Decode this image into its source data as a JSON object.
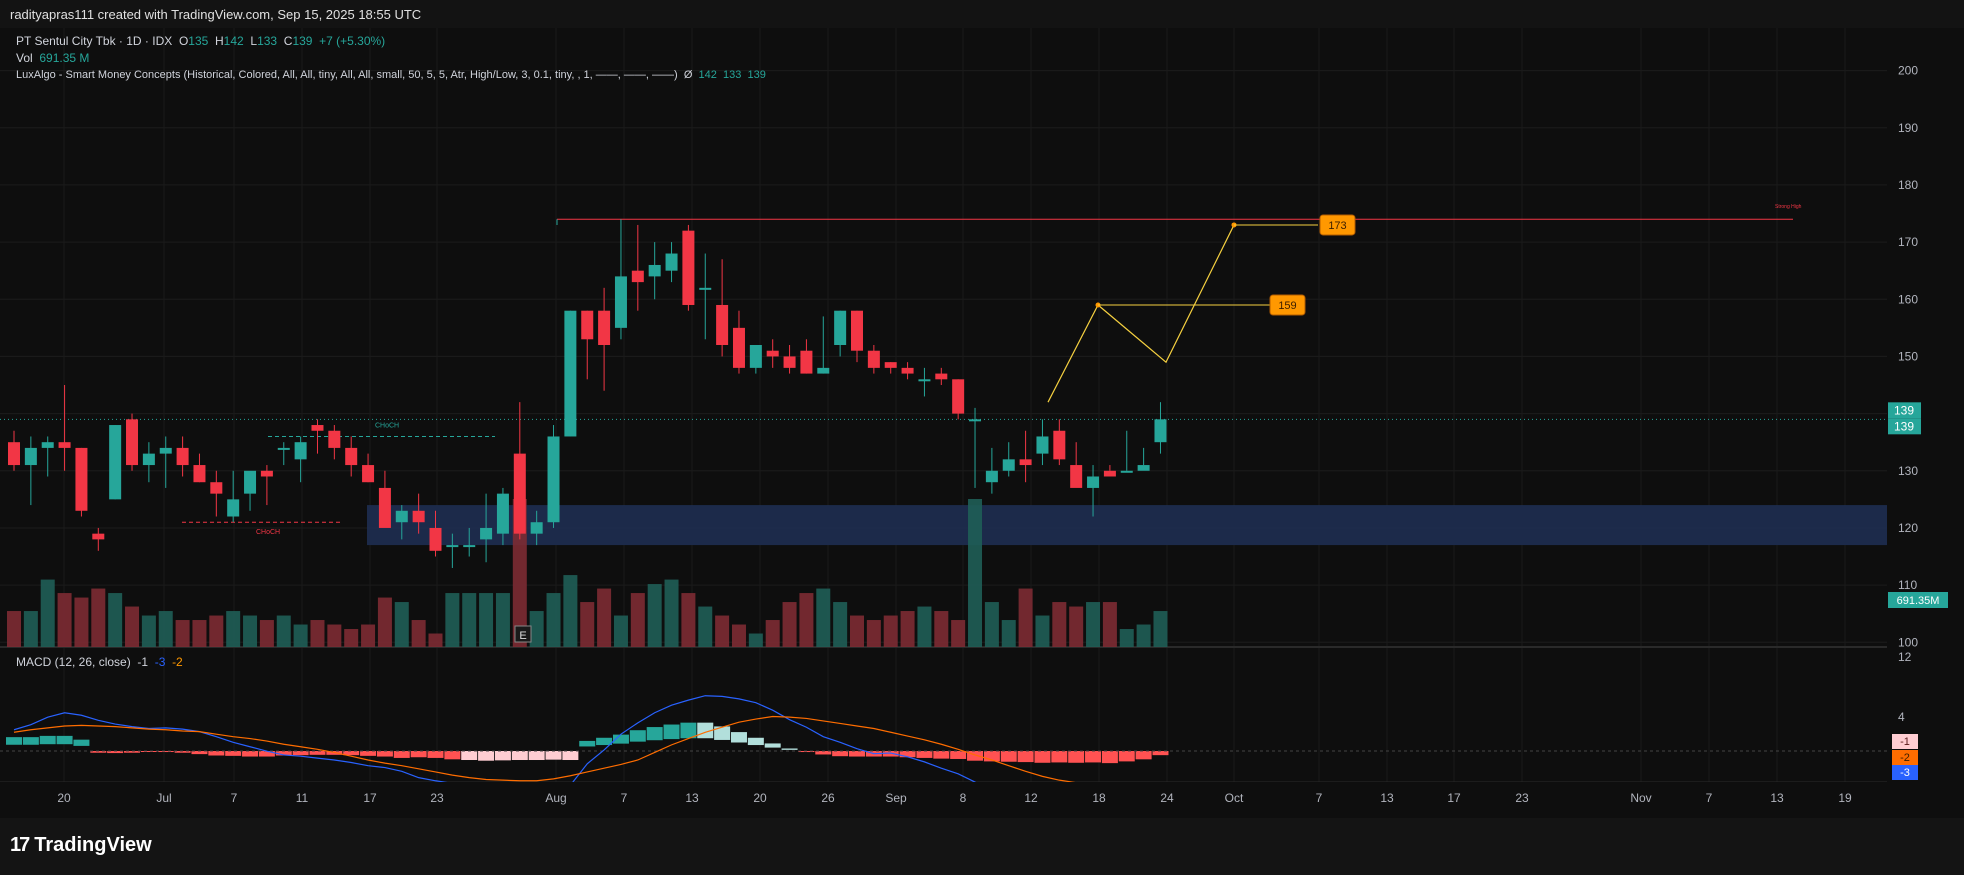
{
  "header": {
    "text": "radityapras111 created with TradingView.com, Sep 15, 2025 18:55 UTC"
  },
  "legend": {
    "symbol": "PT Sentul City Tbk · 1D · IDX",
    "o_label": "O",
    "o": "135",
    "h_label": "H",
    "h": "142",
    "l_label": "L",
    "l": "133",
    "c_label": "C",
    "c": "139",
    "change": "+7 (+5.30%)",
    "vol_label": "Vol",
    "vol": "691.35 M",
    "indicator": "LuxAlgo - Smart Money Concepts (Historical, Colored, All, All, tiny, All, All, small, 50, 5, 5, Atr, High/Low, 3, 0.1, tiny, , 1, ——, ——, ——)",
    "indicator_sym": "Ø",
    "ind_v1": "142",
    "ind_v2": "133",
    "ind_v3": "139",
    "macd_label": "MACD (12, 26, close)",
    "macd_v1": "-1",
    "macd_v2": "-3",
    "macd_v3": "-2"
  },
  "footer": {
    "brand": "TradingView"
  },
  "colors": {
    "up": "#26a69a",
    "down": "#f23645",
    "volUp": "#1f5e57",
    "volDown": "#7d2b33",
    "macd": "#2962ff",
    "signal": "#ff6d00",
    "zone": "#1e2f55",
    "projection": "#f5d040",
    "target": "#ff9800"
  },
  "chart_data": {
    "type": "candlestick",
    "price_axis": {
      "ticks": [
        100,
        110,
        120,
        130,
        140,
        150,
        160,
        170,
        180,
        190,
        200
      ],
      "range": [
        99,
        205
      ]
    },
    "x_ticks": [
      "20",
      "Jul",
      "7",
      "11",
      "17",
      "23",
      "Aug",
      "7",
      "13",
      "20",
      "26",
      "Sep",
      "8",
      "12",
      "18",
      "24",
      "Oct",
      "7",
      "13",
      "17",
      "23",
      "Nov",
      "7",
      "13",
      "19"
    ],
    "candles": [
      [
        135,
        137,
        130,
        131
      ],
      [
        131,
        136,
        124,
        134
      ],
      [
        134,
        136,
        129,
        135
      ],
      [
        135,
        145,
        130,
        134
      ],
      [
        134,
        134,
        122,
        123
      ],
      [
        119,
        120,
        116,
        118
      ],
      [
        125,
        138,
        125,
        138
      ],
      [
        139,
        140,
        130,
        131
      ],
      [
        131,
        135,
        128,
        133
      ],
      [
        133,
        136,
        127,
        134
      ],
      [
        134,
        136,
        129,
        131
      ],
      [
        131,
        133,
        128,
        128
      ],
      [
        128,
        130,
        122,
        126
      ],
      [
        122,
        130,
        121,
        125
      ],
      [
        126,
        129,
        123,
        130
      ],
      [
        130,
        131,
        124,
        129
      ],
      [
        134,
        135,
        131,
        134
      ],
      [
        132,
        136,
        128,
        135
      ],
      [
        138,
        139,
        133,
        137
      ],
      [
        137,
        138,
        132,
        134
      ],
      [
        134,
        136,
        129,
        131
      ],
      [
        131,
        133,
        128,
        128
      ],
      [
        127,
        130,
        122,
        120
      ],
      [
        121,
        124,
        118,
        123
      ],
      [
        123,
        126,
        119,
        121
      ],
      [
        120,
        123,
        115,
        116
      ],
      [
        117,
        119,
        113,
        117
      ],
      [
        117,
        120,
        115,
        117
      ],
      [
        118,
        126,
        114,
        120
      ],
      [
        119,
        127,
        117,
        126
      ],
      [
        133,
        142,
        118,
        119
      ],
      [
        119,
        123,
        117,
        121
      ],
      [
        121,
        138,
        120,
        136
      ],
      [
        136,
        158,
        136,
        158
      ],
      [
        158,
        158,
        146,
        153
      ],
      [
        158,
        162,
        144,
        152
      ],
      [
        155,
        174,
        153,
        164
      ],
      [
        165,
        173,
        158,
        163
      ],
      [
        164,
        170,
        160,
        166
      ],
      [
        165,
        170,
        163,
        168
      ],
      [
        172,
        173,
        158,
        159
      ],
      [
        162,
        168,
        153,
        162
      ],
      [
        159,
        167,
        150,
        152
      ],
      [
        155,
        158,
        147,
        148
      ],
      [
        148,
        152,
        147,
        152
      ],
      [
        151,
        153,
        148,
        150
      ],
      [
        150,
        152,
        147,
        148
      ],
      [
        151,
        153,
        147,
        147
      ],
      [
        147,
        157,
        147,
        148
      ],
      [
        152,
        158,
        150,
        158
      ],
      [
        158,
        158,
        149,
        151
      ],
      [
        151,
        152,
        147,
        148
      ],
      [
        149,
        149,
        147,
        148
      ],
      [
        148,
        149,
        146,
        147
      ],
      [
        146,
        148,
        143,
        146
      ],
      [
        147,
        148,
        145,
        146
      ],
      [
        146,
        146,
        139,
        140
      ],
      [
        139,
        141,
        127,
        139
      ],
      [
        128,
        134,
        126,
        130
      ],
      [
        130,
        135,
        129,
        132
      ],
      [
        132,
        137,
        128,
        131
      ],
      [
        133,
        139,
        131,
        136
      ],
      [
        137,
        139,
        131,
        132
      ],
      [
        131,
        135,
        128,
        127
      ],
      [
        127,
        131,
        122,
        129
      ],
      [
        130,
        131,
        130,
        129
      ],
      [
        130,
        137,
        130,
        130
      ],
      [
        130,
        134,
        131,
        131
      ],
      [
        135,
        142,
        133,
        139
      ]
    ],
    "volume": [
      8,
      8,
      15,
      12,
      11,
      13,
      12,
      9,
      7,
      8,
      6,
      6,
      7,
      8,
      7,
      6,
      7,
      5,
      6,
      5,
      4,
      5,
      11,
      10,
      6,
      3,
      12,
      12,
      12,
      12,
      72,
      8,
      12,
      16,
      10,
      13,
      7,
      12,
      14,
      15,
      12,
      9,
      7,
      5,
      3,
      6,
      10,
      12,
      13,
      10,
      7,
      6,
      7,
      8,
      9,
      8,
      6,
      40,
      10,
      6,
      13,
      7,
      10,
      9,
      10,
      10,
      4,
      5,
      8
    ],
    "volume_axis_label": "691.35M",
    "macd": {
      "axis_ticks": [
        12,
        4
      ],
      "histogram": [
        2.2,
        2.2,
        2.4,
        2.4,
        1.8,
        -0.5,
        -0.6,
        -0.5,
        -0.2,
        -0.3,
        -0.5,
        -0.9,
        -1.3,
        -1.4,
        -1.6,
        -1.6,
        -1.3,
        -1.2,
        -1.1,
        -1.1,
        -1.2,
        -1.4,
        -1.6,
        -2.0,
        -1.8,
        -2.0,
        -2.4,
        -2.6,
        -2.8,
        -2.7,
        -2.6,
        -2.6,
        -2.5,
        -2.6,
        1.6,
        2.1,
        2.6,
        3.3,
        3.8,
        4.2,
        4.5,
        4.5,
        3.9,
        3.0,
        2.1,
        1.2,
        0.4,
        -0.3,
        -1.0,
        -1.5,
        -1.6,
        -1.6,
        -1.6,
        -1.8,
        -2.0,
        -2.2,
        -2.3,
        -2.8,
        -3.0,
        -3.1,
        -3.2,
        -3.4,
        -3.3,
        -3.4,
        -3.3,
        -3.5,
        -3.0,
        -2.4,
        -1.2
      ],
      "macd_line": [
        7.5,
        8.3,
        9.5,
        10.2,
        9.8,
        9.0,
        8.4,
        8.0,
        7.7,
        7.8,
        7.6,
        7.2,
        6.4,
        5.5,
        4.8,
        4.1,
        3.5,
        3.3,
        3.0,
        2.7,
        2.3,
        1.8,
        1.5,
        0.9,
        -0.1,
        -0.6,
        -1.0,
        -1.5,
        -1.8,
        -2.1,
        -2.0,
        -1.9,
        -1.7,
        -1.3,
        2.1,
        4.3,
        6.8,
        8.6,
        10.2,
        11.4,
        12.2,
        12.9,
        12.8,
        12.4,
        11.8,
        10.6,
        9.1,
        7.9,
        6.4,
        5.5,
        4.5,
        3.7,
        3.8,
        3.2,
        2.4,
        1.4,
        0.5,
        -0.8,
        -2.2,
        -2.8,
        -3.1,
        -3.2,
        -3.4,
        -3.5,
        -3.6,
        -3.8,
        -4.2,
        -3.8,
        -3.3
      ],
      "signal_line": [
        7.1,
        7.5,
        7.8,
        8.1,
        8.2,
        8.1,
        8.0,
        7.8,
        7.6,
        7.5,
        7.3,
        7.2,
        6.8,
        6.4,
        6.1,
        5.7,
        5.2,
        4.8,
        4.4,
        3.9,
        3.3,
        2.7,
        2.2,
        1.8,
        1.3,
        0.8,
        0.3,
        -0.1,
        -0.4,
        -0.5,
        -0.6,
        -0.6,
        -0.3,
        0.2,
        0.8,
        1.4,
        2.0,
        2.7,
        3.9,
        5.1,
        6.1,
        7.1,
        7.9,
        8.7,
        9.2,
        9.6,
        9.5,
        9.3,
        8.9,
        8.5,
        8.1,
        7.7,
        7.1,
        6.5,
        5.9,
        5.2,
        4.4,
        3.5,
        2.7,
        1.8,
        0.9,
        0.1,
        -0.5,
        -0.9,
        -1.3,
        -1.6,
        -1.8,
        -1.9,
        -2.0
      ]
    },
    "zone": [
      117,
      124
    ],
    "strong_high": {
      "price": 174,
      "label": "Strong High"
    },
    "choch_up": {
      "price": 136,
      "label": "CHoCH"
    },
    "choch_down": {
      "price": 121,
      "label": "CHoCH"
    },
    "projection": [
      [
        139,
        142
      ],
      [
        145,
        159
      ],
      [
        149,
        149
      ],
      [
        153,
        173
      ]
    ],
    "targets": [
      {
        "value": "173",
        "price": 173
      },
      {
        "value": "159",
        "price": 159
      }
    ],
    "price_labels": [
      "139",
      "139"
    ],
    "macd_labels": [
      "-1",
      "-2",
      "-3"
    ],
    "earnings_marker": "E"
  }
}
